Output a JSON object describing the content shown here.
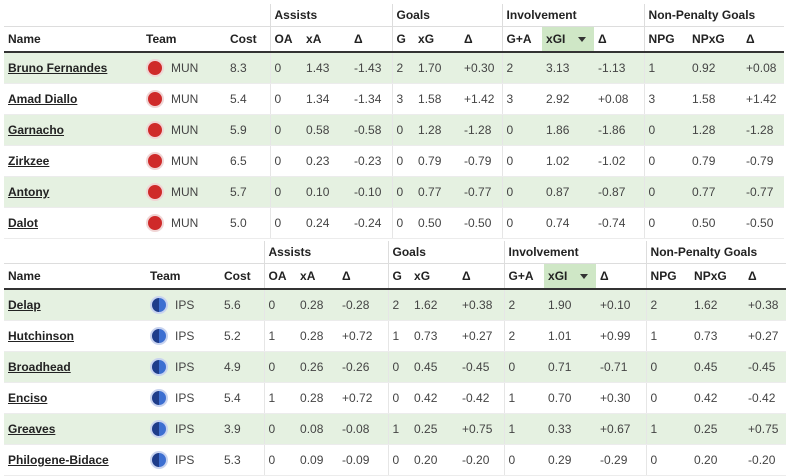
{
  "groups": {
    "assists": "Assists",
    "goals": "Goals",
    "involvement": "Involvement",
    "npg": "Non-Penalty Goals"
  },
  "columns": [
    "Name",
    "Team",
    "Cost",
    "OA",
    "xA",
    "Δ",
    "G",
    "xG",
    "Δ",
    "G+A",
    "xGI",
    "Δ",
    "NPG",
    "NPxG",
    "Δ"
  ],
  "sort": {
    "column": "xGI",
    "direction": "descending",
    "icon": "caret-down-icon"
  },
  "tables": [
    {
      "team": "MUN",
      "crest_color": "#cf2a2a",
      "rows": [
        {
          "name": "Bruno Fernandes",
          "team": "MUN",
          "cost": "8.3",
          "oa": "0",
          "xa": "1.43",
          "da": "-1.43",
          "g": "2",
          "xg": "1.70",
          "dg": "+0.30",
          "ga": "2",
          "xgi": "3.13",
          "di": "-1.13",
          "npg": "1",
          "npxg": "0.92",
          "dn": "+0.08"
        },
        {
          "name": "Amad Diallo",
          "team": "MUN",
          "cost": "5.4",
          "oa": "0",
          "xa": "1.34",
          "da": "-1.34",
          "g": "3",
          "xg": "1.58",
          "dg": "+1.42",
          "ga": "3",
          "xgi": "2.92",
          "di": "+0.08",
          "npg": "3",
          "npxg": "1.58",
          "dn": "+1.42"
        },
        {
          "name": "Garnacho",
          "team": "MUN",
          "cost": "5.9",
          "oa": "0",
          "xa": "0.58",
          "da": "-0.58",
          "g": "0",
          "xg": "1.28",
          "dg": "-1.28",
          "ga": "0",
          "xgi": "1.86",
          "di": "-1.86",
          "npg": "0",
          "npxg": "1.28",
          "dn": "-1.28"
        },
        {
          "name": "Zirkzee",
          "team": "MUN",
          "cost": "6.5",
          "oa": "0",
          "xa": "0.23",
          "da": "-0.23",
          "g": "0",
          "xg": "0.79",
          "dg": "-0.79",
          "ga": "0",
          "xgi": "1.02",
          "di": "-1.02",
          "npg": "0",
          "npxg": "0.79",
          "dn": "-0.79"
        },
        {
          "name": "Antony",
          "team": "MUN",
          "cost": "5.7",
          "oa": "0",
          "xa": "0.10",
          "da": "-0.10",
          "g": "0",
          "xg": "0.77",
          "dg": "-0.77",
          "ga": "0",
          "xgi": "0.87",
          "di": "-0.87",
          "npg": "0",
          "npxg": "0.77",
          "dn": "-0.77"
        },
        {
          "name": "Dalot",
          "team": "MUN",
          "cost": "5.0",
          "oa": "0",
          "xa": "0.24",
          "da": "-0.24",
          "g": "0",
          "xg": "0.50",
          "dg": "-0.50",
          "ga": "0",
          "xgi": "0.74",
          "di": "-0.74",
          "npg": "0",
          "npxg": "0.50",
          "dn": "-0.50"
        }
      ]
    },
    {
      "team": "IPS",
      "crest_color": "#1e3c8a",
      "rows": [
        {
          "name": "Delap",
          "team": "IPS",
          "cost": "5.6",
          "oa": "0",
          "xa": "0.28",
          "da": "-0.28",
          "g": "2",
          "xg": "1.62",
          "dg": "+0.38",
          "ga": "2",
          "xgi": "1.90",
          "di": "+0.10",
          "npg": "2",
          "npxg": "1.62",
          "dn": "+0.38"
        },
        {
          "name": "Hutchinson",
          "team": "IPS",
          "cost": "5.2",
          "oa": "1",
          "xa": "0.28",
          "da": "+0.72",
          "g": "1",
          "xg": "0.73",
          "dg": "+0.27",
          "ga": "2",
          "xgi": "1.01",
          "di": "+0.99",
          "npg": "1",
          "npxg": "0.73",
          "dn": "+0.27"
        },
        {
          "name": "Broadhead",
          "team": "IPS",
          "cost": "4.9",
          "oa": "0",
          "xa": "0.26",
          "da": "-0.26",
          "g": "0",
          "xg": "0.45",
          "dg": "-0.45",
          "ga": "0",
          "xgi": "0.71",
          "di": "-0.71",
          "npg": "0",
          "npxg": "0.45",
          "dn": "-0.45"
        },
        {
          "name": "Enciso",
          "team": "IPS",
          "cost": "5.4",
          "oa": "1",
          "xa": "0.28",
          "da": "+0.72",
          "g": "0",
          "xg": "0.42",
          "dg": "-0.42",
          "ga": "1",
          "xgi": "0.70",
          "di": "+0.30",
          "npg": "0",
          "npxg": "0.42",
          "dn": "-0.42"
        },
        {
          "name": "Greaves",
          "team": "IPS",
          "cost": "3.9",
          "oa": "0",
          "xa": "0.08",
          "da": "-0.08",
          "g": "1",
          "xg": "0.25",
          "dg": "+0.75",
          "ga": "1",
          "xgi": "0.33",
          "di": "+0.67",
          "npg": "1",
          "npxg": "0.25",
          "dn": "+0.75"
        },
        {
          "name": "Philogene-Bidace",
          "team": "IPS",
          "cost": "5.3",
          "oa": "0",
          "xa": "0.09",
          "da": "-0.09",
          "g": "0",
          "xg": "0.20",
          "dg": "-0.20",
          "ga": "0",
          "xgi": "0.29",
          "di": "-0.29",
          "npg": "0",
          "npxg": "0.20",
          "dn": "-0.20"
        }
      ]
    }
  ]
}
